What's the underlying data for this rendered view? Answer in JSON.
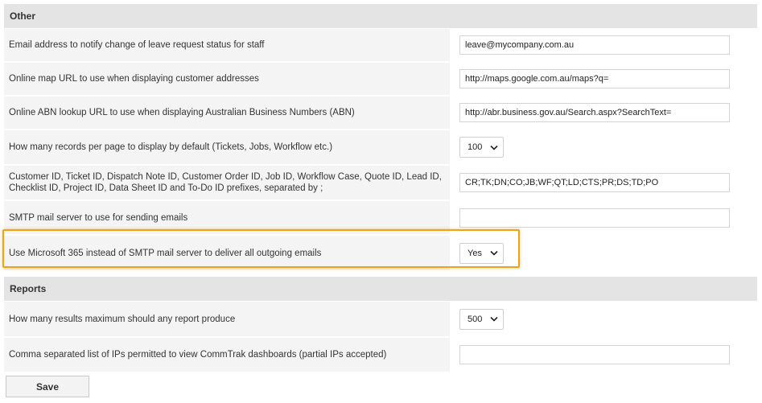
{
  "sections": [
    {
      "title": "Other",
      "rows": [
        {
          "label": "Email address to notify change of leave request status for staff",
          "type": "input",
          "value": "leave@mycompany.com.au"
        },
        {
          "label": "Online map URL to use when displaying customer addresses",
          "type": "input",
          "value": "http://maps.google.com.au/maps?q="
        },
        {
          "label": "Online ABN lookup URL to use when displaying Australian Business Numbers (ABN)",
          "type": "input",
          "value": "http://abr.business.gov.au/Search.aspx?SearchText="
        },
        {
          "label": "How many records per page to display by default (Tickets, Jobs, Workflow etc.)",
          "type": "select",
          "value": "100"
        },
        {
          "label": "Customer ID, Ticket ID, Dispatch Note ID, Customer Order ID, Job ID, Workflow Case, Quote ID, Lead ID, Checklist ID, Project ID, Data Sheet ID and To-Do ID prefixes, separated by ;",
          "type": "input",
          "value": "CR;TK;DN;CO;JB;WF;QT;LD;CTS;PR;DS;TD;PO"
        },
        {
          "label": "SMTP mail server to use for sending emails",
          "type": "input",
          "value": ""
        },
        {
          "label": "Use Microsoft 365 instead of SMTP mail server to deliver all outgoing emails",
          "type": "select",
          "value": "Yes",
          "highlighted": true
        }
      ]
    },
    {
      "title": "Reports",
      "rows": [
        {
          "label": "How many results maximum should any report produce",
          "type": "select",
          "value": "500"
        },
        {
          "label": "Comma separated list of IPs permitted to view CommTrak dashboards (partial IPs accepted)",
          "type": "input",
          "value": ""
        }
      ]
    }
  ],
  "save_label": "Save",
  "colors": {
    "highlight": "#f0a21b",
    "header_bg": "#e4e4e4",
    "row_bg": "#f4f4f4"
  },
  "icons": {
    "select_arrow": "chevron-down-icon"
  }
}
